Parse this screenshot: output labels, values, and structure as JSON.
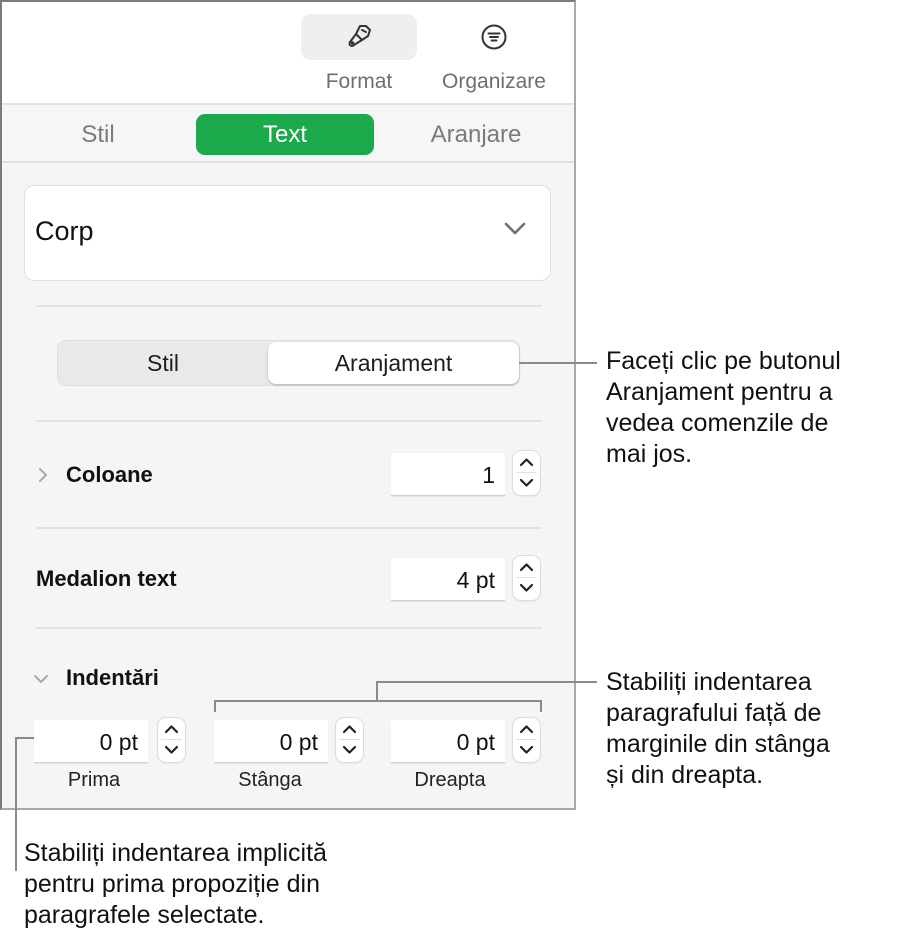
{
  "toolbar": {
    "buttons": [
      {
        "label": "Format",
        "icon": "paintbrush-icon",
        "active": true
      },
      {
        "label": "Organizare",
        "icon": "organize-icon",
        "active": false
      }
    ]
  },
  "tabs": [
    {
      "label": "Stil",
      "active": false
    },
    {
      "label": "Text",
      "active": true
    },
    {
      "label": "Aranjare",
      "active": false
    }
  ],
  "paragraph_style": {
    "value": "Corp",
    "icon": "chevron-down-icon"
  },
  "segmented": [
    {
      "label": "Stil",
      "active": false
    },
    {
      "label": "Aranjament",
      "active": true
    }
  ],
  "columns": {
    "label": "Coloane",
    "value": "1",
    "expanded": false
  },
  "text_inset": {
    "label": "Medalion text",
    "value": "4 pt"
  },
  "indents": {
    "label": "Indentări",
    "expanded": true,
    "fields": [
      {
        "label": "Prima",
        "value": "0 pt"
      },
      {
        "label": "Stânga",
        "value": "0 pt"
      },
      {
        "label": "Dreapta",
        "value": "0 pt"
      }
    ]
  },
  "callouts": {
    "arrangement": [
      "Faceți clic pe butonul",
      "Aranjament pentru a",
      "vedea comenzile de",
      "mai jos."
    ],
    "left_right": [
      "Stabiliți indentarea",
      "paragrafului față de",
      "marginile din stânga",
      "și din dreapta."
    ],
    "first": [
      "Stabiliți indentarea implicită",
      "pentru prima propoziție din",
      "paragrafele selectate."
    ]
  },
  "colors": {
    "accent": "#1ba94c",
    "panel_bg": "#f5f5f5"
  }
}
